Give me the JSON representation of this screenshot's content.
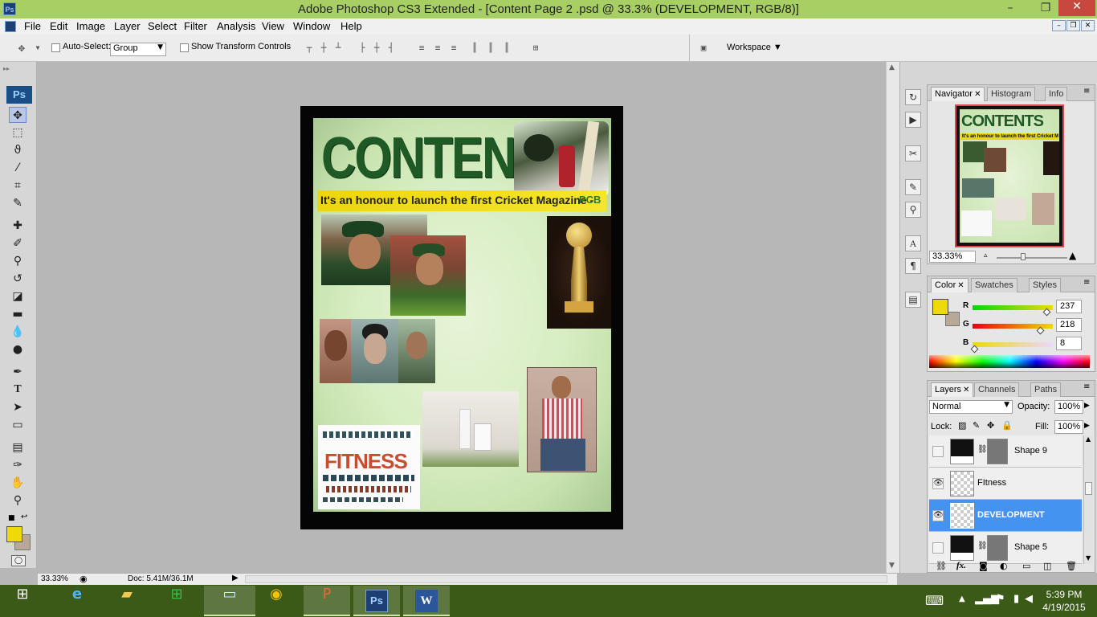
{
  "window": {
    "title": "Adobe Photoshop CS3 Extended - [Content Page 2 .psd @ 33.3% (DEVELOPMENT, RGB/8)]",
    "app_badge": "Ps",
    "minimize": "–",
    "maximize": "❐",
    "close": "✕"
  },
  "menu": [
    "File",
    "Edit",
    "Image",
    "Layer",
    "Select",
    "Filter",
    "Analysis",
    "View",
    "Window",
    "Help"
  ],
  "options": {
    "auto_select_label": "Auto-Select:",
    "auto_select_value": "Group",
    "show_transform_label": "Show Transform Controls",
    "workspace_label": "Workspace ▼"
  },
  "toolbox": {
    "badge": "Ps",
    "tools": [
      "move",
      "marquee",
      "lasso",
      "magic-wand",
      "crop",
      "slice",
      "healing",
      "brush",
      "stamp",
      "history-brush",
      "eraser",
      "gradient",
      "blur",
      "dodge",
      "pen",
      "type",
      "path-select",
      "shape",
      "notes",
      "eyedropper",
      "hand",
      "zoom"
    ],
    "type_glyph": "T",
    "foreground_color": "#EDDA08",
    "background_color": "#B8A898"
  },
  "document": {
    "heading": "CONTENTS",
    "tagline": "It's an honour to launch the first Cricket Magazine -",
    "tagline_tag": "PCB",
    "fitness_word": "FITNESS"
  },
  "status": {
    "zoom": "33.33%",
    "doc": "Doc: 5.41M/36.1M"
  },
  "navigator": {
    "tabs": [
      "Navigator",
      "Histogram",
      "Info"
    ],
    "mini_heading": "CONTENTS",
    "mini_tagline": "It's an honour to launch the first Cricket Magazine",
    "zoom": "33.33%"
  },
  "color_panel": {
    "tabs": [
      "Color",
      "Swatches",
      "Styles"
    ],
    "channels": [
      {
        "label": "R",
        "value": "237",
        "level": 0.93
      },
      {
        "label": "G",
        "value": "218",
        "level": 0.85
      },
      {
        "label": "B",
        "value": "8",
        "level": 0.03
      }
    ],
    "fg": "#EDDA08",
    "bg": "#B8A898"
  },
  "layers_panel": {
    "tabs": [
      "Layers",
      "Channels",
      "Paths"
    ],
    "blend_mode": "Normal",
    "opacity_label": "Opacity:",
    "opacity": "100%",
    "lock_label": "Lock:",
    "fill_label": "Fill:",
    "fill": "100%",
    "layers": [
      {
        "name": "Shape 9",
        "visible": false,
        "selected": false
      },
      {
        "name": "FItness",
        "visible": true,
        "selected": false
      },
      {
        "name": "DEVELOPMENT",
        "visible": true,
        "selected": true
      },
      {
        "name": "Shape 5",
        "visible": false,
        "selected": false
      }
    ],
    "footer_icons": [
      "link-icon",
      "fx-icon",
      "mask-icon",
      "adjustment-icon",
      "folder-icon",
      "new-layer-icon",
      "trash-icon"
    ],
    "fx_label": "fx."
  },
  "taskbar": {
    "apps": [
      "windows-start",
      "internet-explorer",
      "file-explorer",
      "store",
      "remote-desktop",
      "chrome",
      "powerpoint",
      "photoshop",
      "word"
    ],
    "time": "5:39 PM",
    "date": "4/19/2015"
  }
}
